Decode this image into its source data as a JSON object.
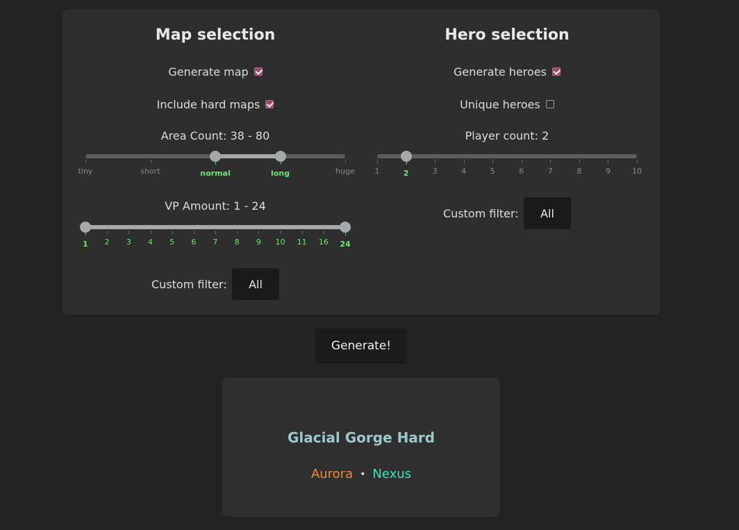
{
  "map": {
    "heading": "Map selection",
    "generate_map_label": "Generate map",
    "generate_map_checked": true,
    "include_hard_label": "Include hard maps",
    "include_hard_checked": true,
    "area_label": "Area Count: 38 - 80",
    "area_ticks": [
      "tiny",
      "short",
      "normal",
      "long",
      "huge"
    ],
    "area_active": [
      "normal",
      "long"
    ],
    "vp_label": "VP Amount: 1 - 24",
    "vp_ticks": [
      "1",
      "2",
      "3",
      "4",
      "5",
      "6",
      "7",
      "8",
      "9",
      "10",
      "11",
      "16",
      "24"
    ],
    "vp_active": [
      "1",
      "24"
    ],
    "filter_label": "Custom filter:",
    "filter_value": "All"
  },
  "hero": {
    "heading": "Hero selection",
    "generate_heroes_label": "Generate heroes",
    "generate_heroes_checked": true,
    "unique_label": "Unique heroes",
    "unique_checked": false,
    "player_label": "Player count: 2",
    "player_ticks": [
      "1",
      "2",
      "3",
      "4",
      "5",
      "6",
      "7",
      "8",
      "9",
      "10"
    ],
    "player_active": [
      "2"
    ],
    "filter_label": "Custom filter:",
    "filter_value": "All"
  },
  "generate_button": "Generate!",
  "result": {
    "map_name": "Glacial Gorge Hard",
    "hero_1": "Aurora",
    "separator": "•",
    "hero_2": "Nexus"
  },
  "colors": {
    "accent_green": "#6ee66e",
    "checkbox": "#9a4a6a",
    "map_name": "#9cc7cc",
    "hero_1": "#f08a2e",
    "hero_2": "#3fe0c0"
  }
}
